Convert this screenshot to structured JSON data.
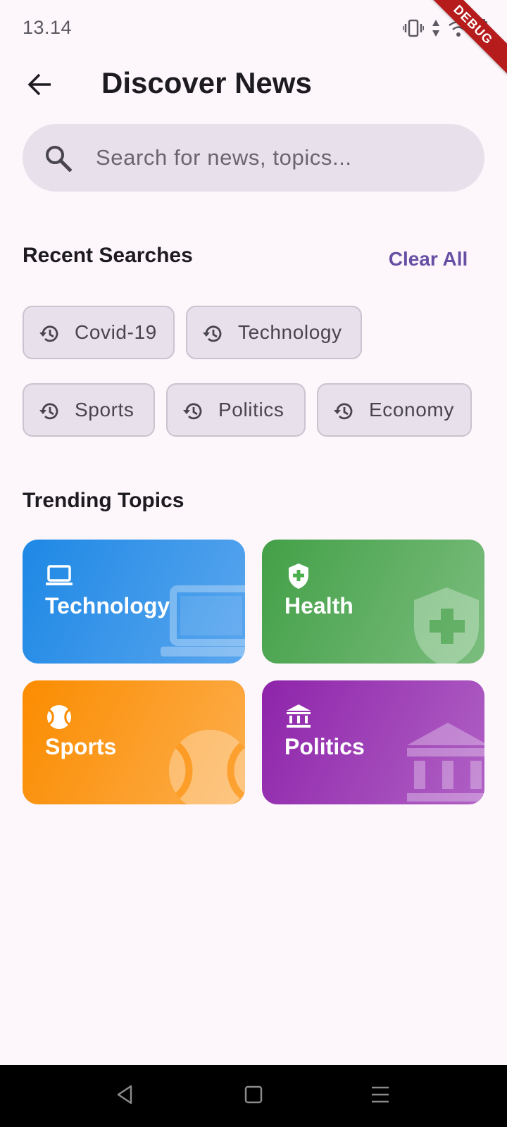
{
  "status_bar": {
    "time": "13.14",
    "icons": [
      "vibrate-icon",
      "data-arrows-icon",
      "wifi-icon",
      "battery-icon"
    ]
  },
  "debug_banner": "DEBUG",
  "header": {
    "back_icon": "arrow-back-icon",
    "title": "Discover News"
  },
  "search": {
    "icon": "search-icon",
    "placeholder": "Search for news, topics...",
    "value": ""
  },
  "recent_searches": {
    "title": "Recent Searches",
    "clear_label": "Clear All",
    "items": [
      {
        "label": "Covid-19",
        "icon": "history-icon"
      },
      {
        "label": "Technology",
        "icon": "history-icon"
      },
      {
        "label": "Sports",
        "icon": "history-icon"
      },
      {
        "label": "Politics",
        "icon": "history-icon"
      },
      {
        "label": "Economy",
        "icon": "history-icon"
      }
    ]
  },
  "trending": {
    "title": "Trending Topics",
    "topics": [
      {
        "label": "Technology",
        "icon": "laptop-icon",
        "color_start": "#1e88e5",
        "color_end": "#5aa6ee"
      },
      {
        "label": "Health",
        "icon": "health-shield-icon",
        "color_start": "#43a047",
        "color_end": "#7bbd7e"
      },
      {
        "label": "Sports",
        "icon": "sports-ball-icon",
        "color_start": "#fb8c00",
        "color_end": "#fcae4d"
      },
      {
        "label": "Politics",
        "icon": "government-building-icon",
        "color_start": "#8e24aa",
        "color_end": "#b061c5"
      }
    ]
  },
  "nav": {
    "back": "nav-back-icon",
    "home": "nav-home-icon",
    "recents": "nav-menu-icon"
  },
  "colors": {
    "background": "#fdf7fc",
    "accent": "#6750a4",
    "search_bg": "#e8e0ea"
  }
}
